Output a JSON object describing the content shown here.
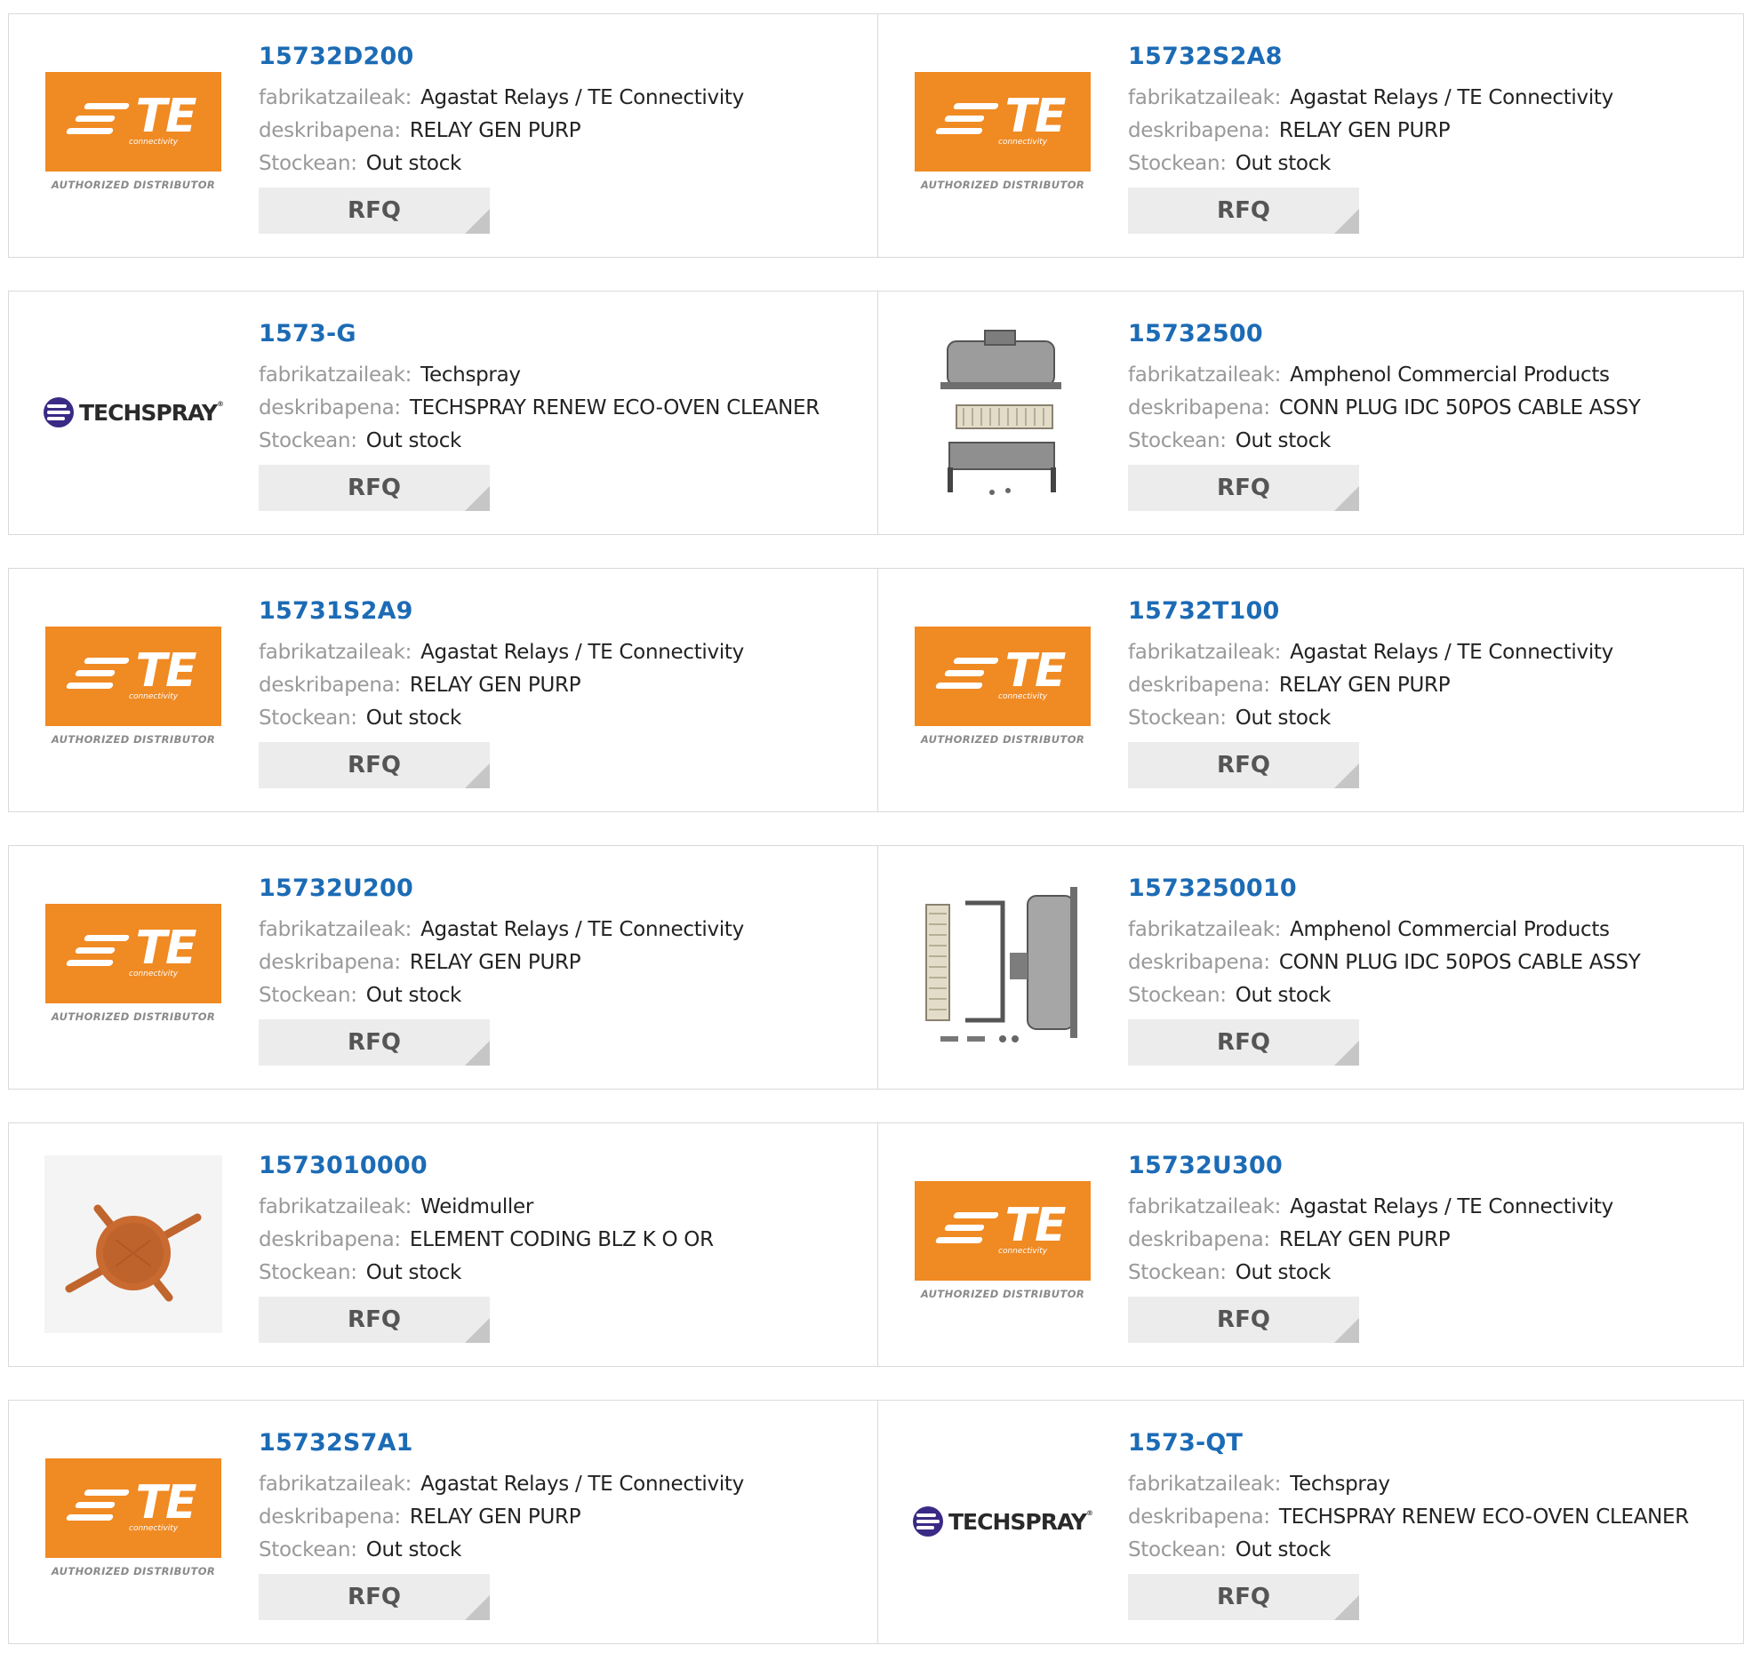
{
  "labels": {
    "manufacturer": "fabrikatzaileak:",
    "description": "deskribapena:",
    "stock": "Stockean:",
    "rfq": "RFQ"
  },
  "logos": {
    "te_letters": "TE",
    "te_sub": "connectivity",
    "te_auth": "AUTHORIZED DISTRIBUTOR",
    "techspray": "TECHSPRAY",
    "techspray_reg": "®"
  },
  "colors": {
    "part_link": "#1c6bb5",
    "te_orange": "#f08a23",
    "techspray_purple": "#3a2a85",
    "rfq_bg": "#ececec"
  },
  "products": [
    {
      "part": "15732D200",
      "manufacturer": "Agastat Relays / TE Connectivity",
      "description": "RELAY GEN PURP",
      "stock": "Out stock",
      "image": "te-logo"
    },
    {
      "part": "15732S2A8",
      "manufacturer": "Agastat Relays / TE Connectivity",
      "description": "RELAY GEN PURP",
      "stock": "Out stock",
      "image": "te-logo"
    },
    {
      "part": "1573-G",
      "manufacturer": "Techspray",
      "description": "TECHSPRAY RENEW ECO-OVEN CLEANER",
      "stock": "Out stock",
      "image": "techspray-logo"
    },
    {
      "part": "15732500",
      "manufacturer": "Amphenol Commercial Products",
      "description": "CONN PLUG IDC 50POS CABLE ASSY",
      "stock": "Out stock",
      "image": "connector-photo-vertical"
    },
    {
      "part": "15731S2A9",
      "manufacturer": "Agastat Relays / TE Connectivity",
      "description": "RELAY GEN PURP",
      "stock": "Out stock",
      "image": "te-logo"
    },
    {
      "part": "15732T100",
      "manufacturer": "Agastat Relays / TE Connectivity",
      "description": "RELAY GEN PURP",
      "stock": "Out stock",
      "image": "te-logo"
    },
    {
      "part": "15732U200",
      "manufacturer": "Agastat Relays / TE Connectivity",
      "description": "RELAY GEN PURP",
      "stock": "Out stock",
      "image": "te-logo"
    },
    {
      "part": "1573250010",
      "manufacturer": "Amphenol Commercial Products",
      "description": "CONN PLUG IDC 50POS CABLE ASSY",
      "stock": "Out stock",
      "image": "connector-photo-horizontal"
    },
    {
      "part": "1573010000",
      "manufacturer": "Weidmuller",
      "description": "ELEMENT CODING BLZ K O OR",
      "stock": "Out stock",
      "image": "coding-element-photo"
    },
    {
      "part": "15732U300",
      "manufacturer": "Agastat Relays / TE Connectivity",
      "description": "RELAY GEN PURP",
      "stock": "Out stock",
      "image": "te-logo"
    },
    {
      "part": "15732S7A1",
      "manufacturer": "Agastat Relays / TE Connectivity",
      "description": "RELAY GEN PURP",
      "stock": "Out stock",
      "image": "te-logo"
    },
    {
      "part": "1573-QT",
      "manufacturer": "Techspray",
      "description": "TECHSPRAY RENEW ECO-OVEN CLEANER",
      "stock": "Out stock",
      "image": "techspray-logo"
    }
  ]
}
